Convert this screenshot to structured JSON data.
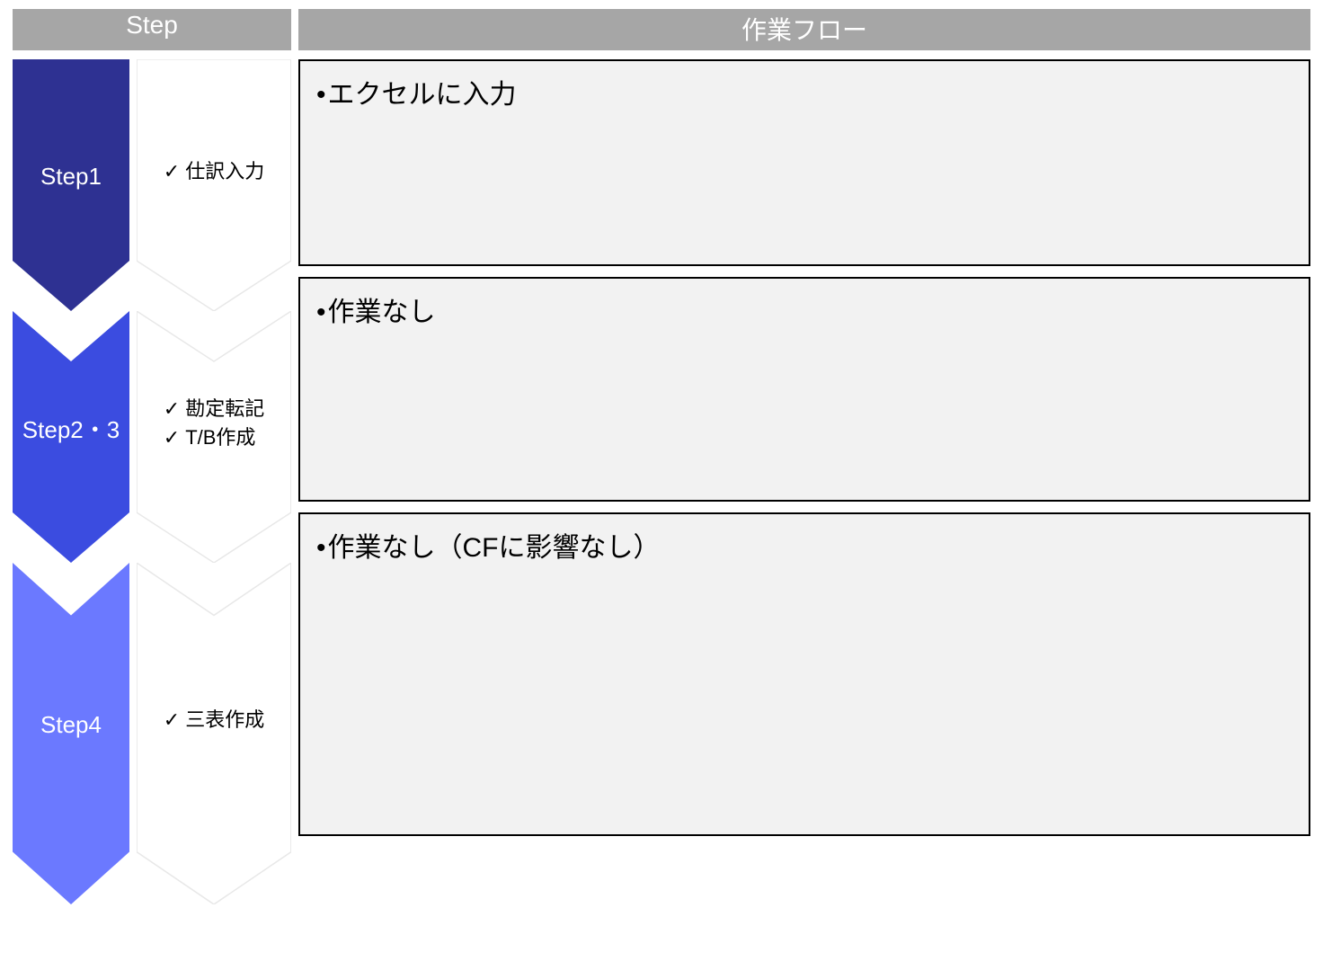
{
  "header": {
    "step": "Step",
    "flow": "作業フロー"
  },
  "steps": [
    {
      "label": "Step1",
      "checks": [
        "仕訳入力"
      ],
      "flow": "エクセルに入力",
      "color": "#2e3192"
    },
    {
      "label": "Step2・3",
      "checks": [
        "勘定転記",
        "T/B作成"
      ],
      "flow": "作業なし",
      "color": "#3b4ce0"
    },
    {
      "label": "Step4",
      "checks": [
        "三表作成"
      ],
      "flow": "作業なし（CFに影響なし）",
      "color": "#6b79ff"
    }
  ]
}
